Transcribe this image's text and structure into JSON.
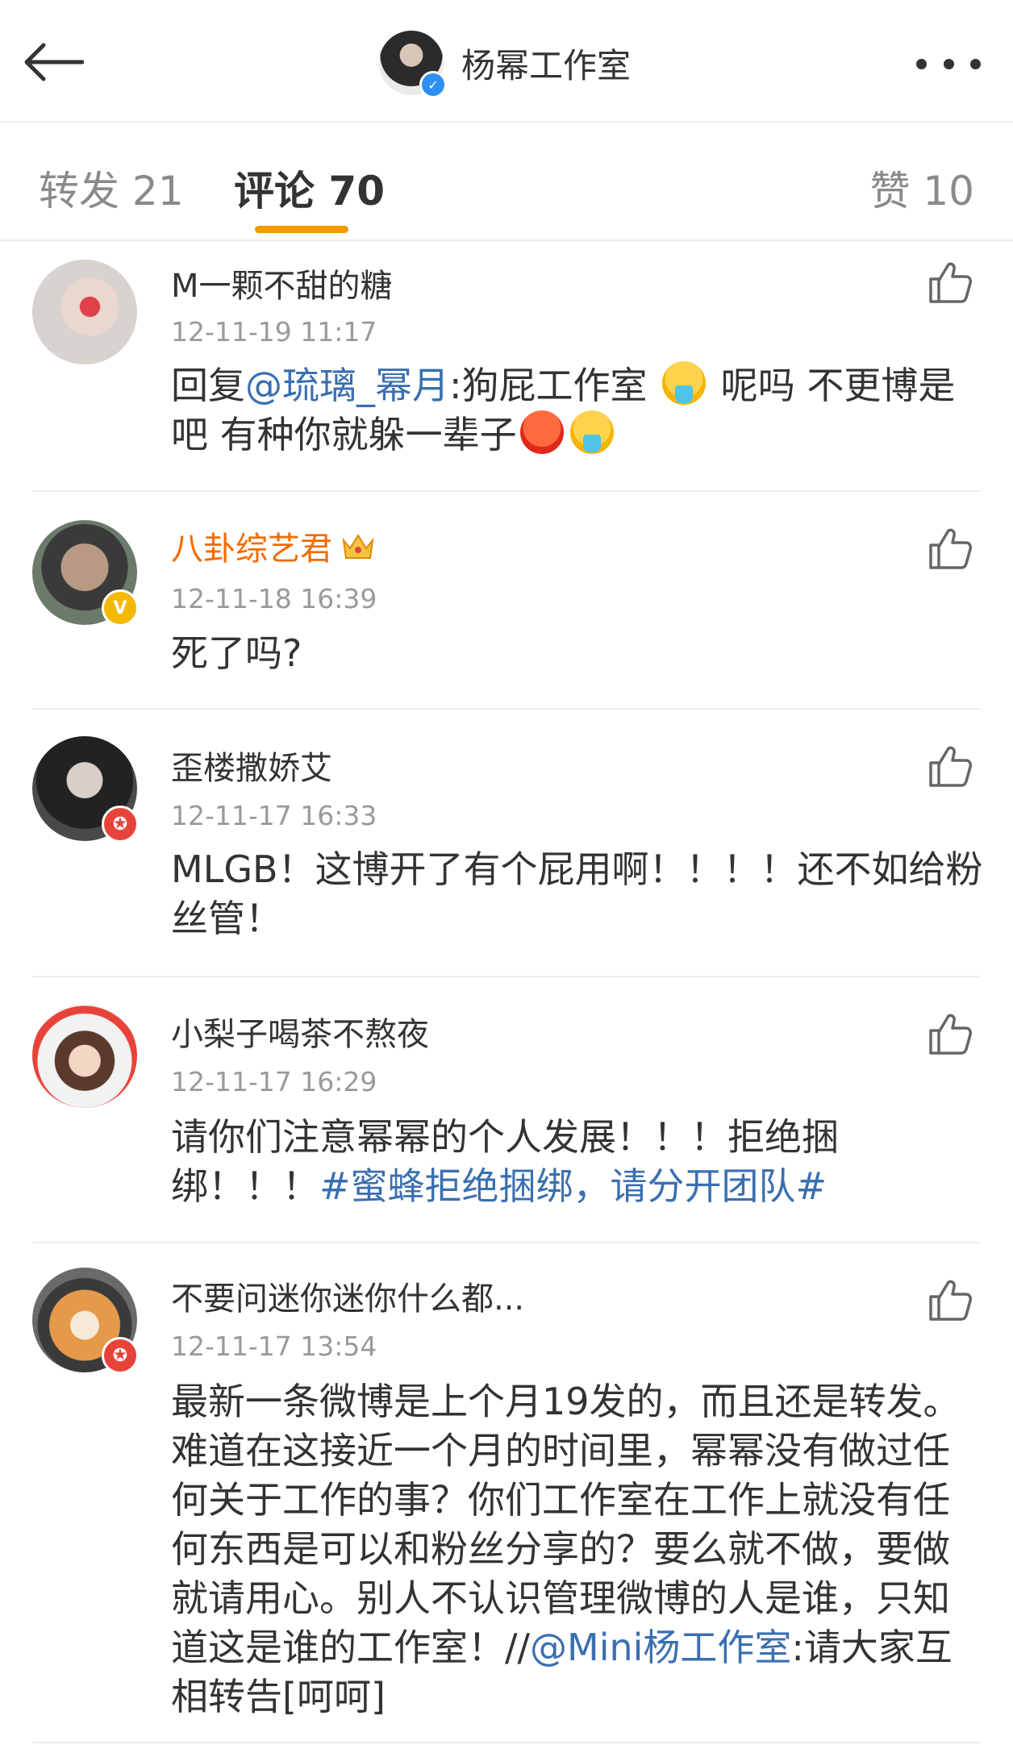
{
  "header": {
    "title": "杨幂工作室",
    "back_icon": "arrow-left-icon",
    "more_icon": "more-dots-icon",
    "verified_icon": "verified-check-icon"
  },
  "tabs": [
    {
      "label": "转发 21",
      "active": false
    },
    {
      "label": "评论 70",
      "active": true
    },
    {
      "label": "赞 10",
      "active": false
    }
  ],
  "colors": {
    "accent": "#f29a00",
    "link": "#3a6fb0",
    "vip_name": "#f26b00",
    "timestamp": "#9a9a9a"
  },
  "comments": [
    {
      "username": "M一颗不甜的糖",
      "time": "12-11-19 11:17",
      "text_prefix": "回复",
      "mention": "@琉璃_幂月",
      "text_mid": ":狗屁工作室 ",
      "text_after_emoji": " 呢吗 不更博是吧 有种你就躲一辈子",
      "emojis": [
        "vomit-emoji",
        "angry-emoji",
        "vomit-emoji"
      ]
    },
    {
      "username": "八卦综艺君",
      "badge_icon": "crown-icon",
      "time": "12-11-18 16:39",
      "text": "死了吗?"
    },
    {
      "username": "歪楼撒娇艾",
      "time": "12-11-17 16:33",
      "text": "MLGB！这博开了有个屁用啊！！！！还不如给粉丝管！"
    },
    {
      "username": "小梨子喝茶不熬夜",
      "time": "12-11-17 16:29",
      "text": "请你们注意幂幂的个人发展！！！拒绝捆绑！！！",
      "hashtag": "#蜜蜂拒绝捆绑，请分开团队#"
    },
    {
      "username": "不要问迷你迷你什么都...",
      "time": "12-11-17 13:54",
      "text": "最新一条微博是上个月19发的，而且还是转发。难道在这接近一个月的时间里，幂幂没有做过任何关于工作的事？你们工作室在工作上就没有任何东西是可以和粉丝分享的？要么就不做，要做就请用心。别人不认识管理微博的人是谁，只知道这是谁的工作室！//",
      "mention": "@Mini杨工作室",
      "text_tail": ":请大家互相转告[呵呵]"
    }
  ],
  "like_icon": "thumbs-up-icon"
}
